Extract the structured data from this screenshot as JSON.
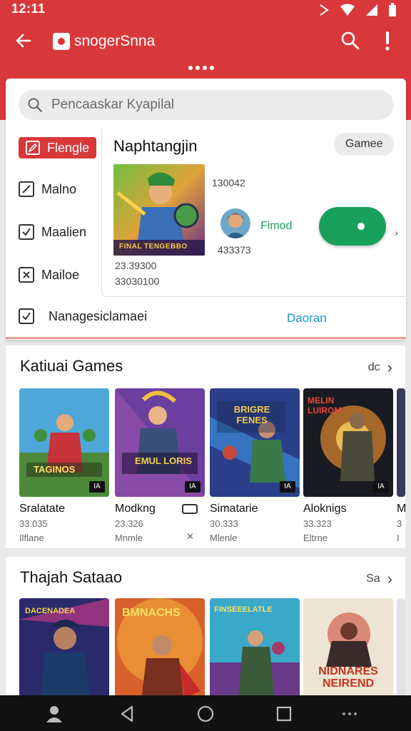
{
  "status_bar": {
    "time": "12:11"
  },
  "app_bar": {
    "title": "snogerSnna"
  },
  "search": {
    "placeholder": "Pencaaskar Kyapilal"
  },
  "sidebar": {
    "items": [
      {
        "label": "Flengle",
        "active": true
      },
      {
        "label": "Malno",
        "active": false
      },
      {
        "label": "Maalien",
        "active": false
      },
      {
        "label": "Mailoe",
        "active": false
      }
    ]
  },
  "detail": {
    "title": "Naphtangjin",
    "badge": "Gamee",
    "thumb_caption": "FINAL TENGEBBO",
    "num1": "130042",
    "user_name": "Fimod",
    "num2": "433373",
    "num3": "23.39300",
    "num4": "33030100",
    "toggle_on": true
  },
  "manage": {
    "label": "Nanagesiclamaei",
    "link": "Daoran"
  },
  "sections": [
    {
      "title": "Katiuai Games",
      "more": "dc",
      "tiles": [
        {
          "name": "Sralatate",
          "meta1": "33.035",
          "meta2": "Ilflane",
          "badge": "IA",
          "art_text": "TAGINOS"
        },
        {
          "name": "Modkng",
          "meta1": "23.326",
          "meta2": "Mnmle",
          "badge": "IA",
          "art_text": "EMUL LORIS"
        },
        {
          "name": "Simatarie",
          "meta1": "30.333",
          "meta2": "Mlenle",
          "badge": "IA",
          "art_text": "BRIGRE FENES"
        },
        {
          "name": "Aloknigs",
          "meta1": "33.323",
          "meta2": "Eltrne",
          "badge": "IA",
          "art_text": "MELIN LUIROM"
        },
        {
          "name": "M",
          "meta1": "3",
          "meta2": "I",
          "badge": "",
          "art_text": ""
        }
      ]
    },
    {
      "title": "Thajah Sataao",
      "more": "Sa",
      "tiles": [
        {
          "name": "",
          "meta1": "",
          "meta2": "",
          "badge": "",
          "art_text": "DACENADEA"
        },
        {
          "name": "",
          "meta1": "",
          "meta2": "",
          "badge": "",
          "art_text": "BMNACHS"
        },
        {
          "name": "",
          "meta1": "",
          "meta2": "",
          "badge": "",
          "art_text": "FINSEEELATLE"
        },
        {
          "name": "",
          "meta1": "",
          "meta2": "",
          "badge": "",
          "art_text": "NIDNARES NEIREND"
        }
      ]
    }
  ],
  "colors": {
    "brand_red": "#d9383a",
    "toggle_green": "#19a05c",
    "link_blue": "#1d8fc8"
  },
  "icons": [
    "back-arrow-icon",
    "search-icon",
    "overflow-menu-icon",
    "checkbox-icon",
    "chevron-right-icon",
    "user-icon",
    "back-triangle-icon",
    "home-circle-icon",
    "recents-square-icon"
  ]
}
